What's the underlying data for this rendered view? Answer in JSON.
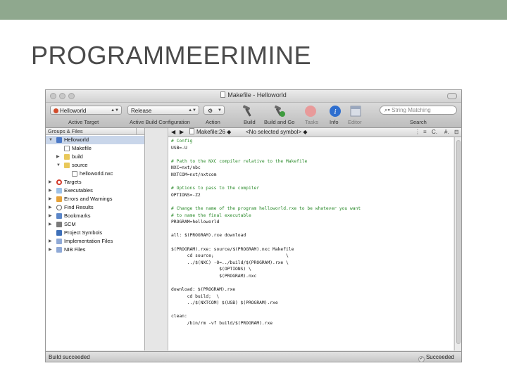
{
  "slide": {
    "title": "PROGRAMMEERIMINE",
    "topbar_color": "#8fa88e"
  },
  "window": {
    "title": "Makefile - Helloworld"
  },
  "toolbar": {
    "target_popup": "Helloworld",
    "config_popup": "Release",
    "target_label": "Active Target",
    "config_label": "Active Build Configuration",
    "action_label": "Action",
    "build_label": "Build",
    "build_go_label": "Build and Go",
    "tasks_label": "Tasks",
    "info_label": "Info",
    "editor_label": "Editor",
    "search_placeholder": "String Matching",
    "search_label": "Search"
  },
  "sidebar": {
    "header": "Groups & Files",
    "items": [
      {
        "label": "Helloworld",
        "icon": "project-icon",
        "disclosure": "open"
      },
      {
        "label": "Makefile",
        "icon": "file-icon",
        "disclosure": "none"
      },
      {
        "label": "build",
        "icon": "folder-icon",
        "disclosure": "closed"
      },
      {
        "label": "source",
        "icon": "folder-icon",
        "disclosure": "open"
      },
      {
        "label": "helloworld.nxc",
        "icon": "file-icon",
        "disclosure": "none"
      },
      {
        "label": "Targets",
        "icon": "target-icon",
        "disclosure": "closed"
      },
      {
        "label": "Executables",
        "icon": "executables-icon",
        "disclosure": "closed"
      },
      {
        "label": "Errors and Warnings",
        "icon": "warning-icon",
        "disclosure": "closed"
      },
      {
        "label": "Find Results",
        "icon": "search-icon",
        "disclosure": "closed"
      },
      {
        "label": "Bookmarks",
        "icon": "bookmarks-icon",
        "disclosure": "closed"
      },
      {
        "label": "SCM",
        "icon": "scm-icon",
        "disclosure": "closed"
      },
      {
        "label": "Project Symbols",
        "icon": "symbols-icon",
        "disclosure": "none"
      },
      {
        "label": "Implementation Files",
        "icon": "smart-group-icon",
        "disclosure": "closed"
      },
      {
        "label": "NIB Files",
        "icon": "smart-group-icon",
        "disclosure": "closed"
      }
    ]
  },
  "editor": {
    "file": "Makefile:26",
    "symbol": "<No selected symbol>",
    "lines": [
      {
        "text": "# Config",
        "type": "c"
      },
      {
        "text": "USB=-U",
        "type": "t"
      },
      {
        "text": "",
        "type": "t"
      },
      {
        "text": "# Path to the NXC compiler relative to the Makefile",
        "type": "c"
      },
      {
        "text": "NXC=nxt/nbc",
        "type": "t"
      },
      {
        "text": "NXTCOM=nxt/nxtcom",
        "type": "t"
      },
      {
        "text": "",
        "type": "t"
      },
      {
        "text": "# Options to pass to the compiler",
        "type": "c"
      },
      {
        "text": "OPTIONS=-Z2",
        "type": "t"
      },
      {
        "text": "",
        "type": "t"
      },
      {
        "text": "# Change the name of the program helloworld.rxe to be whatever you want",
        "type": "c"
      },
      {
        "text": "# to name the final executable",
        "type": "c"
      },
      {
        "text": "PROGRAM=helloworld",
        "type": "t"
      },
      {
        "text": "",
        "type": "t"
      },
      {
        "text": "all: $(PROGRAM).rxe download",
        "type": "t"
      },
      {
        "text": "",
        "type": "t"
      },
      {
        "text": "$(PROGRAM).rxe: source/$(PROGRAM).nxc Makefile",
        "type": "t"
      },
      {
        "text": "      cd source;                           \\",
        "type": "t"
      },
      {
        "text": "      ../$(NXC) -O=../build/$(PROGRAM).rxe \\",
        "type": "t"
      },
      {
        "text": "                  $(OPTIONS) \\",
        "type": "t"
      },
      {
        "text": "                  $(PROGRAM).nxc",
        "type": "t"
      },
      {
        "text": "",
        "type": "t"
      },
      {
        "text": "download: $(PROGRAM).rxe",
        "type": "t"
      },
      {
        "text": "      cd build;  \\",
        "type": "t"
      },
      {
        "text": "      ../$(NXTCOM) $(USB) $(PROGRAM).rxe",
        "type": "t"
      },
      {
        "text": "",
        "type": "t"
      },
      {
        "text": "clean:",
        "type": "t"
      },
      {
        "text": "      /bin/rm -vf build/$(PROGRAM).rxe",
        "type": "t"
      }
    ]
  },
  "status": {
    "left": "Build succeeded",
    "right": "Succeeded"
  }
}
